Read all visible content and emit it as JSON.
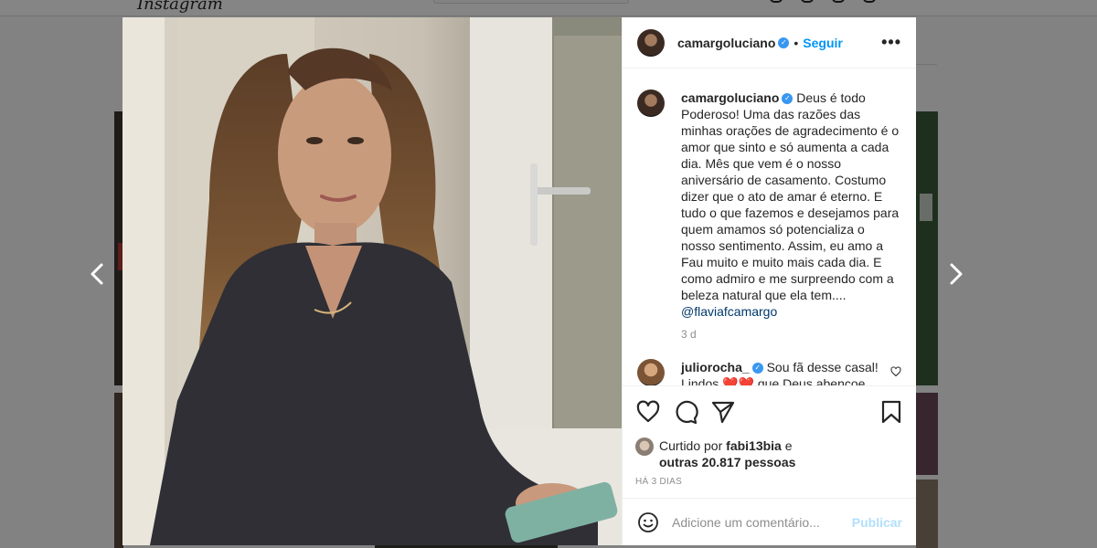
{
  "post": {
    "username": "camargoluciano",
    "verified_mark": "✓",
    "separator": "•",
    "follow_label": "Seguir",
    "more_label": "•••",
    "caption": "Deus é todo Poderoso! Uma das razões das minhas orações de agradecimento é o amor que sinto e só aumenta a cada dia. Mês que vem é o nosso aniversário de casamento. Costumo dizer que o ato de amar é eterno. E tudo o que fazemos e desejamos para quem amamos só potencializa o nosso sentimento. Assim, eu amo a Fau muito e muito mais cada dia. E como admiro e me surpreendo com a beleza natural que ela tem....",
    "mention": "@flaviafcamargo",
    "caption_time": "3 d"
  },
  "comments": [
    {
      "username": "juliorocha_",
      "text": "Sou fã desse casal! Lindos ❤️❤️ que Deus abençoe sempre🙏"
    }
  ],
  "likes": {
    "prefix": "Curtido por",
    "liker": "fabi13bia",
    "conjunction": "e",
    "others": "outras 20.817 pessoas"
  },
  "date_label": "HÁ 3 DIAS",
  "comment_box": {
    "placeholder": "Adicione um comentário...",
    "publish_label": "Publicar"
  },
  "icons": {
    "like": "heart-icon",
    "comment": "comment-icon",
    "share": "paper-plane-icon",
    "save": "bookmark-icon",
    "emoji": "smiley-icon",
    "prev": "chevron-left-icon",
    "next": "chevron-right-icon"
  },
  "colors": {
    "link": "#0095f6",
    "verified": "#3897f0",
    "mention": "#00376b",
    "publish_disabled": "#b2dffc"
  }
}
